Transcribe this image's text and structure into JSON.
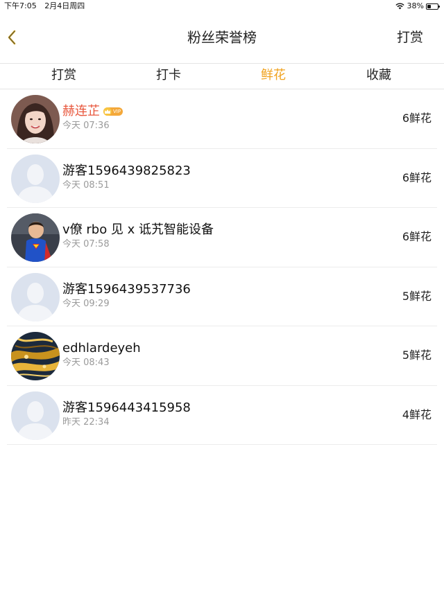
{
  "status_bar": {
    "time": "下午7:05",
    "date": "2月4日周四",
    "battery": "38%",
    "battery_level": 0.38
  },
  "nav": {
    "title": "粉丝荣誉榜",
    "right_label": "打赏"
  },
  "tabs": [
    {
      "label": "打赏",
      "active": false
    },
    {
      "label": "打卡",
      "active": false
    },
    {
      "label": "鲜花",
      "active": true
    },
    {
      "label": "收藏",
      "active": false
    }
  ],
  "fans": [
    {
      "name": "赫连芷",
      "time": "今天 07:36",
      "count": "6鲜花",
      "vip": true,
      "vip_label": "VIP",
      "avatar": "girl-photo"
    },
    {
      "name": "游客1596439825823",
      "time": "今天 08:51",
      "count": "6鲜花",
      "vip": false,
      "avatar": "default-avatar"
    },
    {
      "name": "v僚 rbo 见 x 诋艽智能设备",
      "time": "今天 07:58",
      "count": "6鲜花",
      "vip": false,
      "avatar": "child-superman-photo"
    },
    {
      "name": "游客1596439537736",
      "time": "今天 09:29",
      "count": "5鲜花",
      "vip": false,
      "avatar": "default-avatar"
    },
    {
      "name": "edhlardeyeh",
      "time": "今天 08:43",
      "count": "5鲜花",
      "vip": false,
      "avatar": "golden-abstract-photo"
    },
    {
      "name": "游客1596443415958",
      "time": "昨天 22:34",
      "count": "4鲜花",
      "vip": false,
      "avatar": "default-avatar"
    }
  ],
  "colors": {
    "accent": "#f0a21e",
    "vip_name": "#e8573d",
    "muted": "#9a9a9a"
  }
}
